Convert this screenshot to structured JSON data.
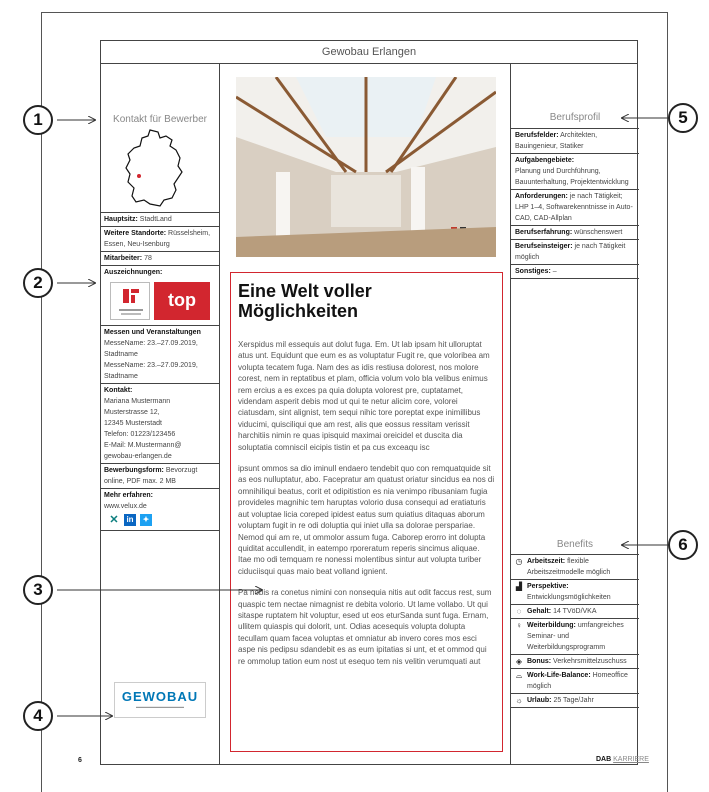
{
  "header": {
    "title": "Gewobau Erlangen"
  },
  "left": {
    "title": "Kontakt für Bewerber",
    "hauptsitz_label": "Hauptsitz:",
    "hauptsitz_value": " StadtLand",
    "standorte_label": "Weitere Standorte:",
    "standorte_value": " Rüsselsheim, Essen, Neu-Isenburg",
    "mitarbeiter_label": "Mitarbeiter:",
    "mitarbeiter_value": " 78",
    "auszeichnungen_label": "Auszeichnungen:",
    "award2_text": "top",
    "messen_label": "Messen und Veranstaltungen",
    "messen_1": "MesseName: 23.–27.09.2019, Stadtname",
    "messen_2": "MesseName: 23.–27.09.2019, Stadtname",
    "kontakt_label": "Kontakt:",
    "kontakt_lines": [
      "Mariana Mustermann",
      "Musterstrasse 12,",
      "12345 Musterstadt",
      "Telefon: 01223/123456",
      "E-Mail: M.Mustermann@",
      "gewobau-erlangen.de"
    ],
    "bewerbung_label": "Bewerbungsform:",
    "bewerbung_value": " Bevorzugt online, PDF max. 2 MB",
    "mehr_label": "Mehr erfahren:",
    "mehr_value": "www.velux.de",
    "logo_text": "GEWOBAU"
  },
  "article": {
    "title": "Eine Welt voller Möglichkeiten",
    "p1": "Xerspidus mil essequis aut dolut fuga. Em. Ut lab ipsam hit ulloruptat atus unt. Equidunt que eum es as voluptatur Fugit re, que voloribea am volupta tecatem fuga. Nam des as idis restiusa dolorest, nos molore corest, nem in reptatibus et plam, officia volum volo bla velibus enimus rem ercius a es exces pa quia dolupta volorest pre, cuptatamet, videndam asperit debis mod ut qui te netur alicim core, volorei ciatusdam, sint alignist, tem sequi nihic tore poreptat expe inimillibus viducimi, quisciliqui que am rest, alis que eossus ressitam verissit harchitiis nimin re quas ipisquid maximai oreicidel et duscita dia soluptatia comniscil eicipis tistin et pa cus exceaqu isc",
    "p2": "ipsunt ommos sa dio iminull endaero tendebit quo con remquatquide sit as eos nulluptatur, abo. Facepratur am quatust oriatur sincidus ea nos di omnihiliqui beatus, corit et odipitistion es nia venimpo ribusaniam fugia provideles magnihic tem haruptas volorio dusa consequi ad eratiaturis aut voluptae licia coreped ipidest eatus sum quiatius ditaquas aborum voluptam fugit in re odi doluptia qui iniet ulla sa dolorae perspariae. Nemod qui am re, ut ommolor assum fuga. Caborep erorro int dolupta quiditat accullendit, in eatempo rporeratum reperis sincimus aliquae. Itae mo odi temquam re nonessi molentibus sintur aut volupta turiber ciduciisqui quas maio beat volland ignient.",
    "p3": "Pa nobis ra conetus nimini con nonsequia nitis aut odit faccus rest, sum quaspic tem nectae nimagnist re debita volorio. Ut lame vollabo. Ut qui sitaspe ruptatem hit voluptur, esed ut eos eturSanda sunt fuga. Ernam, ullitem quiaspis qui dolorit, unt. Odias acesequis volupta dolupta tecullam quam facea voluptas et omniatur ab invero cores mos esci aspe nis pedipsu sdandebit es as eum ipitatias si unt, et et ommod qui re ommolup tation eum nost ut esequo tem nis velitin verumquati aut"
  },
  "right": {
    "title": "Berufsprofil",
    "felder_label": "Berufsfelder:",
    "felder_value": " Architekten, Bauingenieur, Statiker",
    "aufgaben_label": "Aufgabengebiete:",
    "aufgaben_value": "Planung und Durchführung, Bauunterhaltung, Projektentwicklung",
    "anforderungen_label": "Anforderungen:",
    "anforderungen_value": " je nach Tätigkeit; LHP 1–4, Softwarekenntnisse in Auto-CAD, CAD-Allplan",
    "erfahrung_label": "Berufserfahrung:",
    "erfahrung_value": " wünschenswert",
    "einsteiger_label": "Berufseinsteiger:",
    "einsteiger_value": " je nach Tätigkeit möglich",
    "sonstiges_label": "Sonstiges:",
    "sonstiges_value": " –"
  },
  "benefits": {
    "title": "Benefits",
    "items": [
      {
        "label": "Arbeitszeit:",
        "value": " flexible Arbeitszeitmodelle möglich",
        "icon": "clock-icon",
        "glyph": "◷"
      },
      {
        "label": "Perspektive:",
        "value": " Entwicklungsmöglichkeiten",
        "icon": "growth-chart-icon",
        "glyph": "▟"
      },
      {
        "label": "Gehalt:",
        "value": " 14 TVöD/VKA",
        "icon": "money-bag-icon",
        "glyph": "◌"
      },
      {
        "label": "Weiterbildung:",
        "value": " umfangreiches Seminar- und Weiterbildungsprogramm",
        "icon": "lightbulb-icon",
        "glyph": "♀"
      },
      {
        "label": "Bonus:",
        "value": " Verkehrsmittelzuschuss",
        "icon": "diamond-icon",
        "glyph": "◈"
      },
      {
        "label": "Work-Life-Balance:",
        "value": " Homeoffice möglich",
        "icon": "headset-icon",
        "glyph": "⌓"
      },
      {
        "label": "Urlaub:",
        "value": " 25 Tage/Jahr",
        "icon": "sun-icon",
        "glyph": "☼"
      }
    ]
  },
  "callouts": [
    "1",
    "2",
    "3",
    "4",
    "5",
    "6"
  ],
  "footer": {
    "page_number": "6",
    "brand_bold": "DAB",
    "brand_light": "KARRIERE"
  }
}
